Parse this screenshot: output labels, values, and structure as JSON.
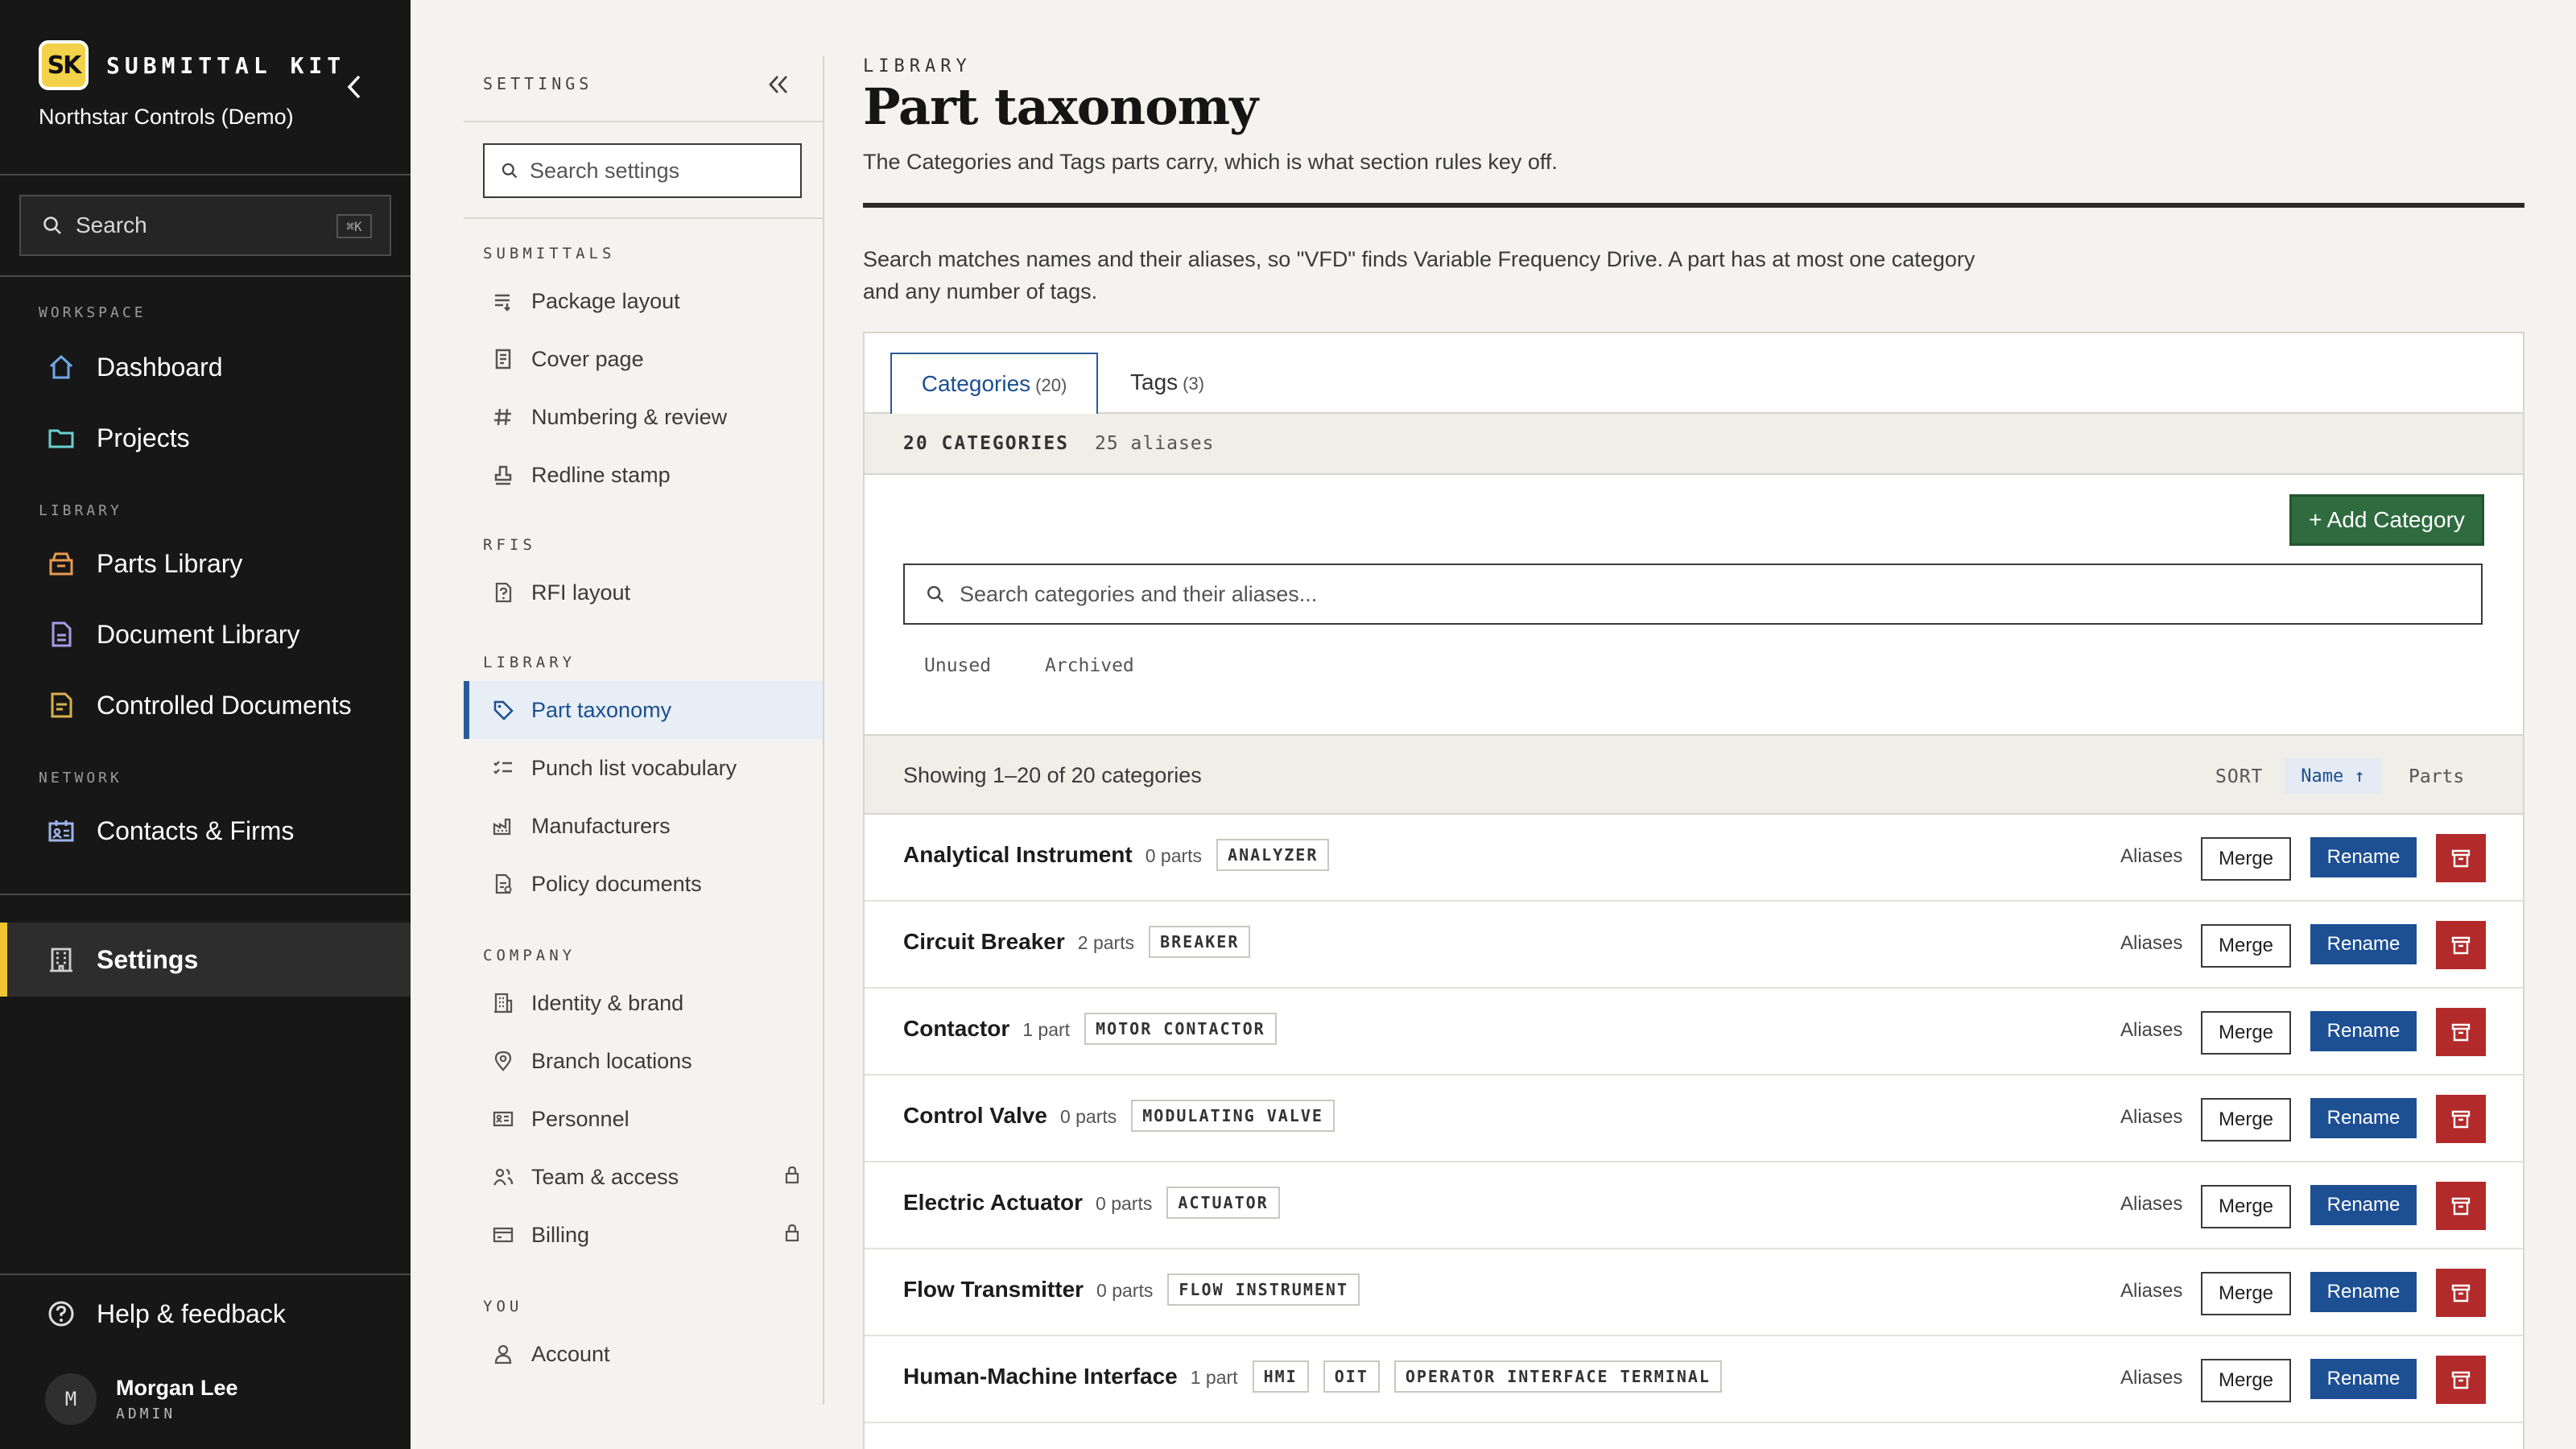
{
  "app": {
    "logo_text": "SK",
    "name": "SUBMITTAL KIT",
    "org": "Northstar Controls (Demo)",
    "accent": "#f2c431"
  },
  "sidebar": {
    "search_label": "Search",
    "search_shortcut": "⌘K",
    "sections": {
      "workspace": "WORKSPACE",
      "library": "LIBRARY",
      "network": "NETWORK"
    },
    "items": {
      "dashboard": {
        "label": "Dashboard",
        "icon": "home-icon"
      },
      "projects": {
        "label": "Projects",
        "icon": "folder-icon"
      },
      "parts_library": {
        "label": "Parts Library",
        "icon": "box-icon"
      },
      "document_library": {
        "label": "Document Library",
        "icon": "document-icon"
      },
      "controlled_documents": {
        "label": "Controlled Documents",
        "icon": "controlled-document-icon"
      },
      "contacts": {
        "label": "Contacts & Firms",
        "icon": "contacts-icon"
      },
      "settings": {
        "label": "Settings",
        "icon": "building-icon"
      },
      "help": {
        "label": "Help & feedback",
        "icon": "help-icon"
      }
    },
    "user": {
      "initial": "M",
      "name": "Morgan Lee",
      "role": "ADMIN"
    }
  },
  "settings": {
    "header": "SETTINGS",
    "search_placeholder": "Search settings",
    "sections": {
      "submittals": "SUBMITTALS",
      "rfis": "RFIS",
      "library": "LIBRARY",
      "company": "COMPANY",
      "you": "YOU"
    },
    "items": {
      "package_layout": "Package layout",
      "cover_page": "Cover page",
      "numbering": "Numbering & review",
      "redline": "Redline stamp",
      "rfi_layout": "RFI layout",
      "part_taxonomy": "Part taxonomy",
      "punch_list": "Punch list vocabulary",
      "manufacturers": "Manufacturers",
      "policy_documents": "Policy documents",
      "identity": "Identity & brand",
      "branch_locations": "Branch locations",
      "personnel": "Personnel",
      "team_access": "Team & access",
      "billing": "Billing",
      "account": "Account"
    }
  },
  "main": {
    "eyebrow": "LIBRARY",
    "title": "Part taxonomy",
    "subtitle": "The Categories and Tags parts carry, which is what section rules key off.",
    "intro": "Search matches names and their aliases, so \"VFD\" finds Variable Frequency Drive. A part has at most one category and any number of tags.",
    "tabs": [
      {
        "label": "Categories",
        "count": "(20)"
      },
      {
        "label": "Tags",
        "count": "(3)"
      }
    ],
    "stats": {
      "categories": "20 CATEGORIES",
      "aliases": "25 aliases"
    },
    "add_button": "+ Add Category",
    "search_placeholder": "Search categories and their aliases...",
    "filters": {
      "unused": "Unused",
      "archived": "Archived"
    },
    "showing": "Showing 1–20 of 20 categories",
    "sort": {
      "label": "SORT",
      "name": "Name ↑",
      "parts": "Parts"
    },
    "row_labels": {
      "aliases": "Aliases",
      "merge": "Merge",
      "rename": "Rename"
    },
    "colors": {
      "primary": "#1d4f93",
      "success": "#2e6b3e",
      "danger": "#b32a2a"
    }
  },
  "categories": [
    {
      "name": "Analytical Instrument",
      "parts": "0 parts",
      "aliases": [
        "ANALYZER"
      ]
    },
    {
      "name": "Circuit Breaker",
      "parts": "2 parts",
      "aliases": [
        "BREAKER"
      ]
    },
    {
      "name": "Contactor",
      "parts": "1 part",
      "aliases": [
        "MOTOR CONTACTOR"
      ]
    },
    {
      "name": "Control Valve",
      "parts": "0 parts",
      "aliases": [
        "MODULATING VALVE"
      ]
    },
    {
      "name": "Electric Actuator",
      "parts": "0 parts",
      "aliases": [
        "ACTUATOR"
      ]
    },
    {
      "name": "Flow Transmitter",
      "parts": "0 parts",
      "aliases": [
        "FLOW INSTRUMENT"
      ]
    },
    {
      "name": "Human-Machine Interface",
      "parts": "1 part",
      "aliases": [
        "HMI",
        "OIT",
        "OPERATOR INTERFACE TERMINAL"
      ]
    }
  ]
}
